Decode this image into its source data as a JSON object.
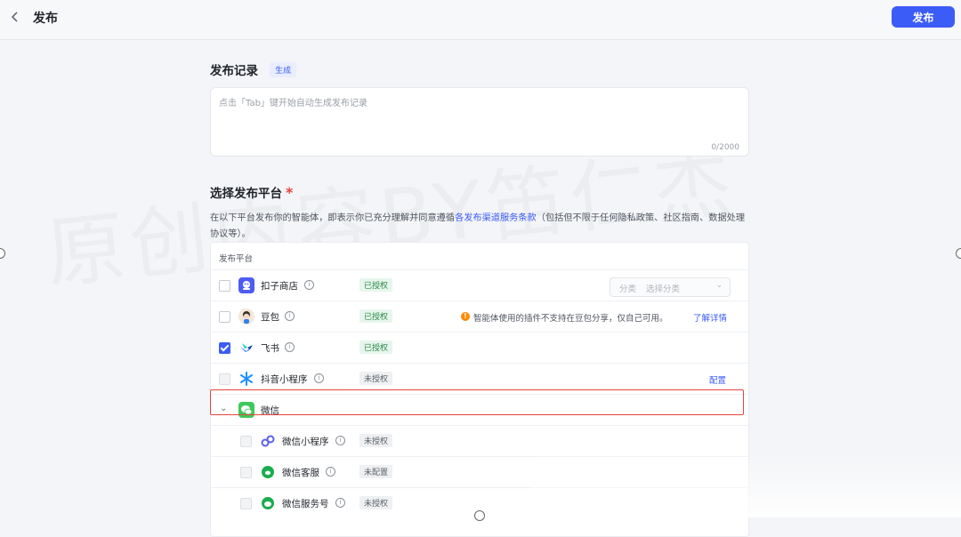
{
  "header": {
    "title": "发布",
    "publish_label": "发布"
  },
  "record": {
    "title": "发布记录",
    "gen_label": "生成",
    "placeholder": "点击「Tab」键开始自动生成发布记录",
    "count": "0/2000"
  },
  "platforms": {
    "title": "选择发布平台",
    "required_mark": "*",
    "desc_before": "在以下平台发布你的智能体，即表示你已充分理解并同意遵循",
    "desc_link": "各发布渠道服务条款",
    "desc_after": "（包括但不限于任何隐私政策、社区指南、数据处理协议等）。",
    "table_header": "发布平台",
    "rows": [
      {
        "name": "扣子商店",
        "status": "已授权",
        "category_label": "分类",
        "category_placeholder": "选择分类"
      },
      {
        "name": "豆包",
        "status": "已授权",
        "warning": "智能体使用的插件不支持在豆包分享，仅自己可用。",
        "learn_more": "了解详情"
      },
      {
        "name": "飞书",
        "status": "已授权"
      },
      {
        "name": "抖音小程序",
        "status": "未授权",
        "action": "配置"
      },
      {
        "name": "微信"
      },
      {
        "name": "微信小程序",
        "status": "未授权"
      },
      {
        "name": "微信客服",
        "status": "未配置"
      },
      {
        "name": "微信服务号",
        "status": "未授权"
      }
    ]
  },
  "watermark": "原创内容BY笛仁杰",
  "colors": {
    "accent": "#3b5cf6",
    "authorized": "#2f8a4c",
    "highlight": "#e5433d",
    "warning": "#ff8a00"
  }
}
